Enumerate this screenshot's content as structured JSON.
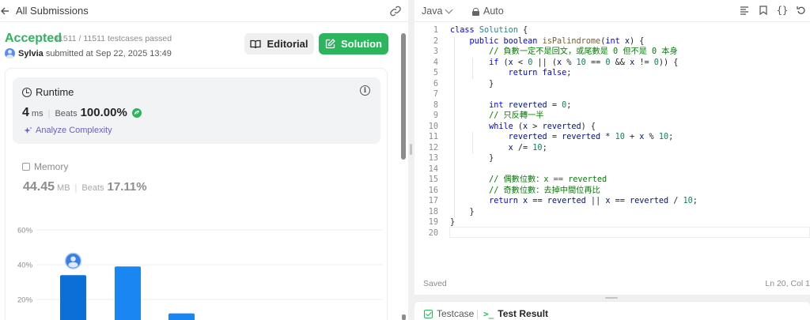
{
  "left_header": {
    "title": "All Submissions"
  },
  "result": {
    "status": "Accepted",
    "testcases": "11511 / 11511 testcases passed",
    "username": "Sylvia",
    "submitted_text": "submitted at Sep 22, 2025 13:49"
  },
  "buttons": {
    "editorial": "Editorial",
    "solution": "Solution"
  },
  "runtime": {
    "title": "Runtime",
    "value": "4",
    "unit": "ms",
    "beats_label": "Beats",
    "beats_pct": "100.00%",
    "analyze_label": "Analyze Complexity"
  },
  "memory": {
    "title": "Memory",
    "value": "44.45",
    "unit": "MB",
    "beats_label": "Beats",
    "beats_pct": "17.11%"
  },
  "chart_data": {
    "type": "bar",
    "yticks": [
      "60%",
      "40%",
      "20%"
    ],
    "ylim": [
      0,
      60
    ],
    "values": [
      34,
      39,
      12
    ],
    "highlight_index": 0,
    "colors": {
      "highlight": "#0a6fd6",
      "normal": "#1a86f2",
      "grid": "#ededed"
    }
  },
  "editor": {
    "language": "Java",
    "mode": "Auto",
    "status_left": "Saved",
    "status_right": "Ln 20, Col 1"
  },
  "code_lines": [
    "class Solution {",
    "    public boolean isPalindrome(int x) {",
    "        // 負數一定不是回文，或尾數是 0 但不是 0 本身",
    "        if (x < 0 || (x % 10 == 0 && x != 0)) {",
    "            return false;",
    "        }",
    "",
    "        int reverted = 0;",
    "        // 只反轉一半",
    "        while (x > reverted) {",
    "            reverted = reverted * 10 + x % 10;",
    "            x /= 10;",
    "        }",
    "",
    "        // 偶數位數：x == reverted",
    "        // 奇數位數：去掉中間位再比",
    "        return x == reverted || x == reverted / 10;",
    "    }",
    "}",
    ""
  ],
  "bottom_tabs": {
    "testcase": "Testcase",
    "test_result": "Test Result"
  },
  "colors": {
    "accepted": "#2db55d",
    "accent": "#2db55d"
  }
}
